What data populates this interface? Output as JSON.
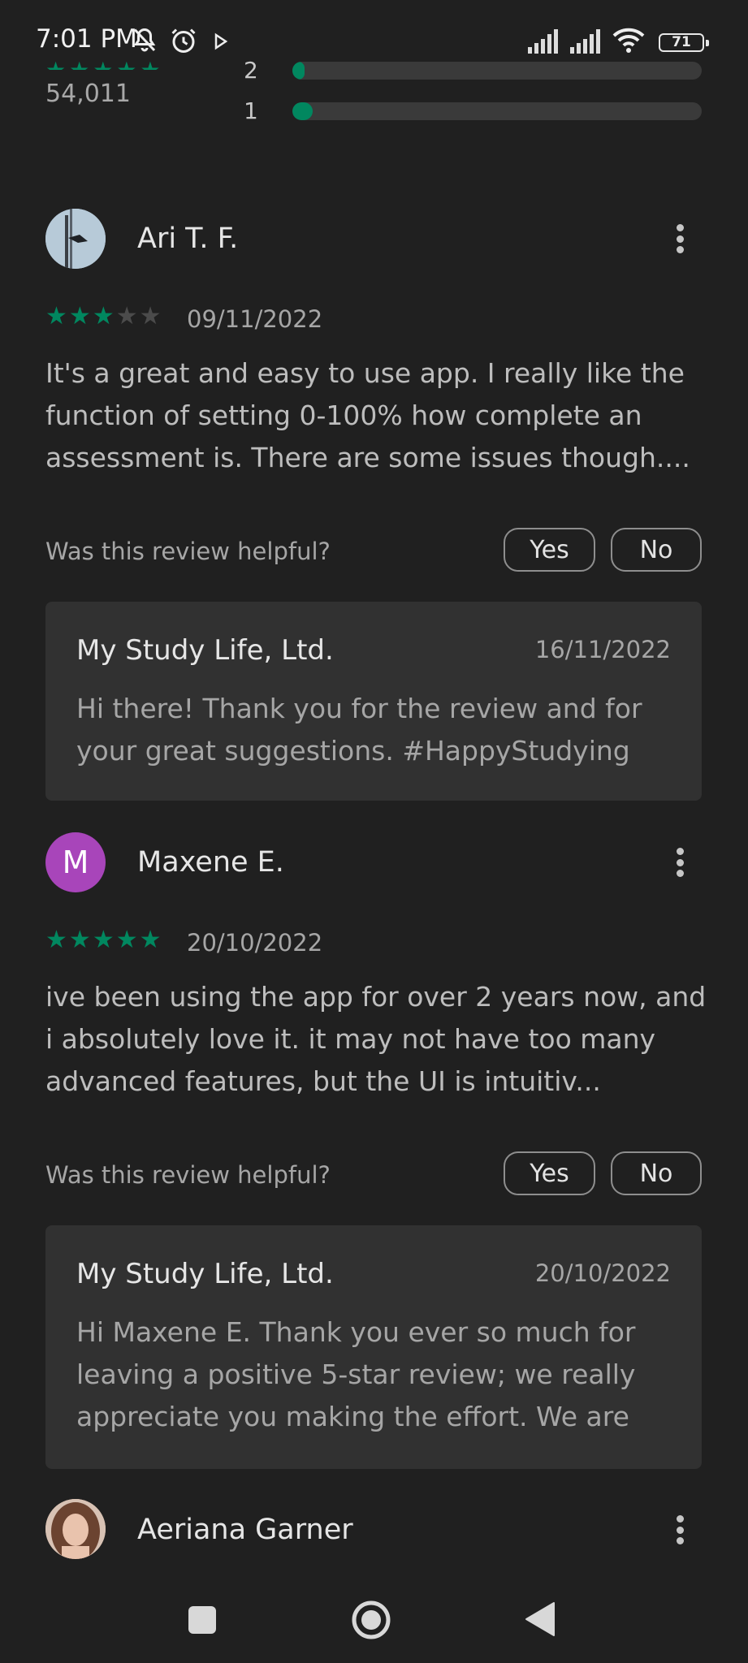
{
  "status_bar": {
    "time": "7:01 PM",
    "battery": "71",
    "icons": [
      "bell-off-icon",
      "alarm-icon",
      "play-icon",
      "signal-icon",
      "signal-icon",
      "wifi-icon",
      "battery-icon"
    ]
  },
  "rating_summary": {
    "total_count": "54,011",
    "bars": [
      {
        "label": "2",
        "fill": 0.03
      },
      {
        "label": "1",
        "fill": 0.05
      }
    ],
    "star_color": "#01875f"
  },
  "reviews": [
    {
      "name": "Ari T. F.",
      "avatar_type": "photo",
      "rating": 3,
      "date": "09/11/2022",
      "text": "It's a great and easy to use app. I really like the function of setting 0-100% how complete an assessment is. There are some issues though....",
      "helpful_question": "Was this review helpful?",
      "yes_label": "Yes",
      "no_label": "No",
      "reply": {
        "developer": "My Study Life, Ltd.",
        "date": "16/11/2022",
        "text": "Hi there! Thank you for the review and for your great suggestions. #HappyStudying"
      }
    },
    {
      "name": "Maxene E.",
      "avatar_type": "initial",
      "avatar_initial": "M",
      "avatar_color": "#a845ba",
      "rating": 5,
      "date": "20/10/2022",
      "text": "ive been using the app for over 2 years now, and i absolutely love it. it may not have too many advanced features, but the UI is intuitiv...",
      "helpful_question": "Was this review helpful?",
      "yes_label": "Yes",
      "no_label": "No",
      "reply": {
        "developer": "My Study Life, Ltd.",
        "date": "20/10/2022",
        "text": "Hi Maxene E. Thank you ever so much for leaving a positive 5-star review; we really appreciate you making the effort. We are"
      }
    },
    {
      "name": "Aeriana Garner",
      "avatar_type": "photo"
    }
  ],
  "nav_bar": {
    "icons": [
      "recents-square-icon",
      "home-circle-icon",
      "back-triangle-icon"
    ]
  }
}
